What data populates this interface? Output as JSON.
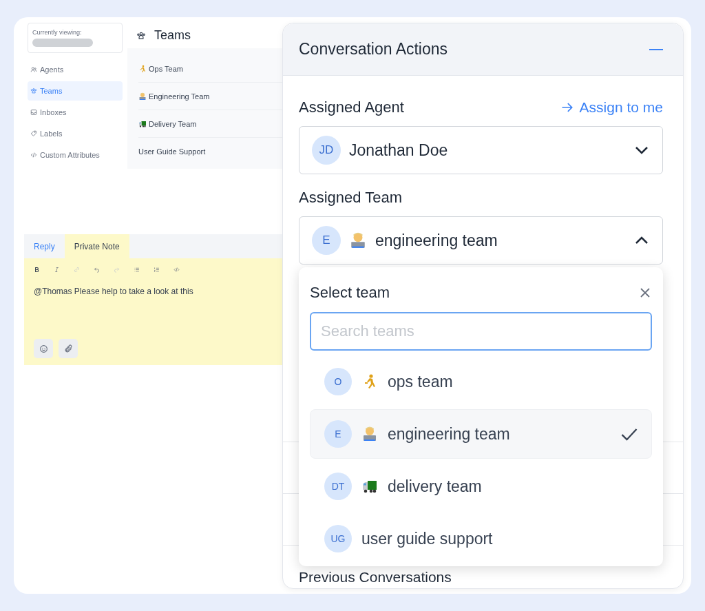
{
  "sidebar": {
    "viewing_label": "Currently viewing:",
    "items": [
      {
        "label": "Agents",
        "selected": false
      },
      {
        "label": "Teams",
        "selected": true
      },
      {
        "label": "Inboxes",
        "selected": false
      },
      {
        "label": "Labels",
        "selected": false
      },
      {
        "label": "Custom Attributes",
        "selected": false
      }
    ]
  },
  "teams_panel": {
    "title": "Teams",
    "rows": [
      {
        "name": "Ops Team",
        "kind": "runner"
      },
      {
        "name": "Engineering Team",
        "kind": "coder"
      },
      {
        "name": "Delivery Team",
        "kind": "truck"
      },
      {
        "name": "User Guide Support",
        "kind": "plain"
      }
    ]
  },
  "editor": {
    "tabs": [
      {
        "label": "Reply",
        "selected": false
      },
      {
        "label": "Private Note",
        "selected": true
      }
    ],
    "value": "@Thomas Please help to take a look at this"
  },
  "actions": {
    "title": "Conversation Actions",
    "expanded": true,
    "assigned_agent": {
      "label": "Assigned Agent",
      "link": "Assign to me",
      "initials": "JD",
      "name": "Jonathan Doe",
      "open": false
    },
    "assigned_team": {
      "label": "Assigned Team",
      "initials": "E",
      "name": "engineering team",
      "kind": "coder",
      "open": true
    },
    "dropdown": {
      "title": "Select team",
      "search": {
        "placeholder": "Search teams"
      },
      "options": [
        {
          "initials": "O",
          "name": "ops team",
          "kind": "runner",
          "selected": false
        },
        {
          "initials": "E",
          "name": "engineering team",
          "kind": "coder",
          "selected": true
        },
        {
          "initials": "DT",
          "name": "delivery team",
          "kind": "truck",
          "selected": false
        },
        {
          "initials": "UG",
          "name": "user guide support",
          "kind": "plain",
          "selected": false
        }
      ]
    },
    "previous": "Previous Conversations"
  }
}
